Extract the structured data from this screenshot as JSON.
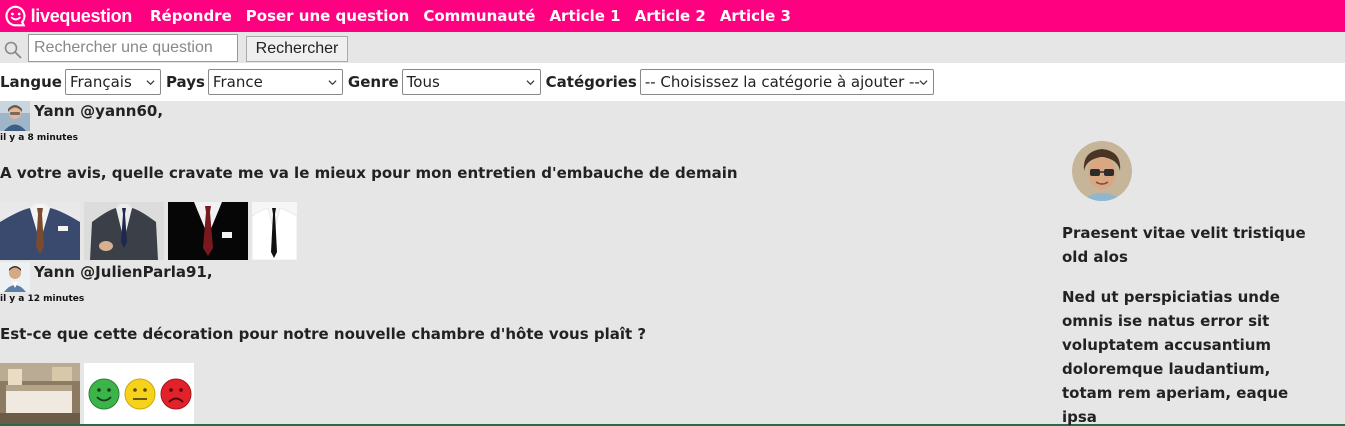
{
  "brand": {
    "logo_text": "livequestion",
    "accent": "#ff0080"
  },
  "nav": {
    "items": [
      "Répondre",
      "Poser une question",
      "Communauté",
      "Article 1",
      "Article 2",
      "Article 3"
    ]
  },
  "search": {
    "placeholder": "Rechercher une question",
    "value": "",
    "button_label": "Rechercher",
    "icon": "search-icon"
  },
  "filters": {
    "langue": {
      "label": "Langue",
      "value": "Français"
    },
    "pays": {
      "label": "Pays",
      "value": "France"
    },
    "genre": {
      "label": "Genre",
      "value": "Tous"
    },
    "categories": {
      "label": "Catégories",
      "value": "-- Choisissez la catégorie à ajouter --"
    }
  },
  "posts": [
    {
      "author": "Yann @yann60,",
      "time": "il y a 8 minutes",
      "question": "A votre avis, quelle cravate me va le mieux pour mon entretien d'embauche de demain",
      "images": [
        "suit-brown-tie",
        "suit-navy-tie",
        "suit-red-tie",
        "suit-black-tie"
      ]
    },
    {
      "author": "Yann @JulienParla91,",
      "time": "il y a 12 minutes",
      "question": "Est-ce que cette décoration pour notre nouvelle chambre d'hôte vous plaît ?",
      "images": [
        "bedroom-photo",
        "rating-smileys"
      ]
    }
  ],
  "sidebar": {
    "text1": "Praesent vitae velit tristique old alos",
    "text2": "Ned ut perspiciatias unde omnis ise natus error sit voluptatem accusantium doloremque laudantium, totam rem aperiam, eaque ipsa"
  }
}
